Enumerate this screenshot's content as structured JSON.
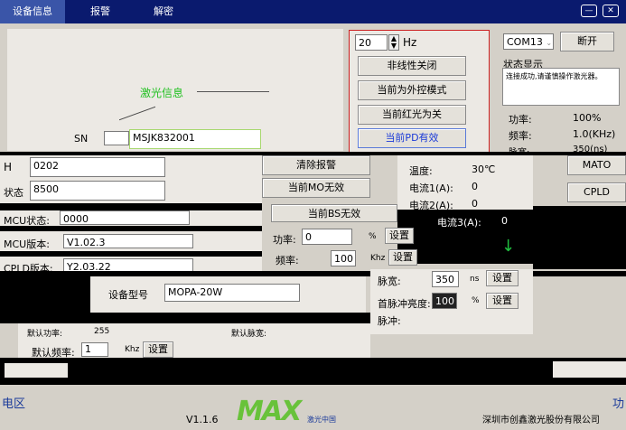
{
  "tabs": [
    {
      "label": "设备信息",
      "active": true
    },
    {
      "label": "报警",
      "active": false
    },
    {
      "label": "解密",
      "active": false
    }
  ],
  "window": {
    "minimize_icon": "minimize-icon",
    "close_icon": "close-icon"
  },
  "freq_spin": {
    "value": "20",
    "unit": "Hz"
  },
  "control_buttons": [
    "非线性关闭",
    "当前为外控模式",
    "当前红光为关",
    "当前PD有效"
  ],
  "port": {
    "selected": "COM13",
    "disconnect_label": "断开"
  },
  "status": {
    "title": "状态显示",
    "message": "连接成功,请谨慎操作激光器。"
  },
  "readouts": {
    "power_label": "功率:",
    "power_value": "100%",
    "freq_label": "频率:",
    "freq_value": "1.0(KHz)",
    "pulse_label": "脉宽:",
    "pulse_value": "350(ns)"
  },
  "device_label": "激光信息",
  "sn": {
    "label": "SN",
    "value": "MSJK832001"
  },
  "left_fields": [
    {
      "label": "H",
      "value": "0202"
    },
    {
      "label": "状态",
      "value": "8500"
    },
    {
      "label": "MCU状态:",
      "value": "0000"
    },
    {
      "label": "MCU版本:",
      "value": "V1.02.3"
    },
    {
      "label": "CPLD版本:",
      "value": "Y2.03.22"
    }
  ],
  "right_cut": {
    "mato": "MATO",
    "cpld": "CPLD"
  },
  "mid_buttons": {
    "clear_alarm": "清除报警",
    "mo_invalid": "当前MO无效",
    "bs_invalid": "当前BS无效"
  },
  "temps": {
    "temp_label": "温度:",
    "temp_value": "30℃",
    "current1_label": "电流1(A):",
    "current1_value": "0",
    "current2_label": "电流2(A):",
    "current2_value": "0",
    "current3_label": "电流3(A):",
    "current3_value": "0"
  },
  "power_set": {
    "label": "功率:",
    "value": "0",
    "unit": "%",
    "set_label": "设置"
  },
  "freq_set": {
    "label": "频率:",
    "value": "100",
    "unit": "Khz",
    "set_label": "设置"
  },
  "pulse_set": {
    "label": "脉宽:",
    "value": "350",
    "unit": "ns",
    "set_label": "设置"
  },
  "first_pulse": {
    "label": "首脉冲亮度:",
    "value": "100",
    "unit": "%",
    "set_label": "设置"
  },
  "pulse_extra_label": "脉冲:",
  "model": {
    "label": "设备型号",
    "value": "MOPA-20W"
  },
  "default_freq": {
    "label": "默认频率:",
    "value": "1",
    "unit": "Khz",
    "set_label": "设置"
  },
  "default_power": {
    "label": "默认功率:",
    "value": "255"
  },
  "default_width": {
    "label": "默认脉宽:"
  },
  "bottom_left": {
    "label": "电区"
  },
  "bottom_right": {
    "label": "功"
  },
  "footer": {
    "version": "V1.1.6",
    "brand": "MAX",
    "brand_sub": "激光中国",
    "company": "深圳市创鑫激光股份有限公司"
  },
  "colors": {
    "topbar": "#0a1a6e",
    "tab_active": "#3a55a8",
    "accent_border": "#cc2020",
    "green": "#68c23a"
  }
}
